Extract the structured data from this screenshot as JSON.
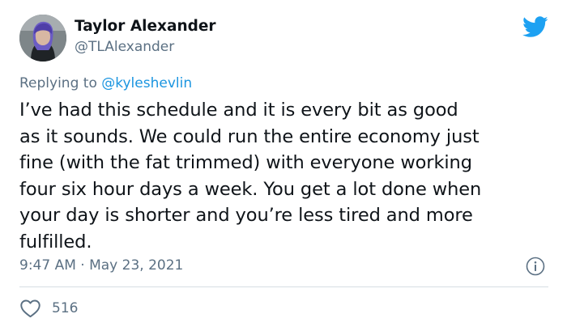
{
  "author": {
    "display_name": "Taylor Alexander",
    "handle": "@TLAlexander",
    "avatar_icon": "avatar-photo"
  },
  "reply": {
    "prefix": "Replying to",
    "mention": "@kyleshevlin"
  },
  "body_lines": [
    "I’ve had this schedule and it is every bit as good",
    "as it sounds. We could run the entire economy just",
    "fine (with the fat trimmed) with everyone working",
    "four six hour days a week. You get a lot done when",
    "your day is shorter and you’re less tired and more",
    "fulfilled."
  ],
  "meta": {
    "timestamp": "9:47 AM · May 23, 2021"
  },
  "actions": {
    "like_count": "516"
  },
  "icons": {
    "brand": "twitter-bird-icon",
    "info": "info-icon",
    "like": "heart-icon"
  },
  "colors": {
    "brand_blue": "#1da1f2",
    "mention_blue": "#1b95e0",
    "secondary_text": "#5b7083",
    "primary_text": "#0f1419",
    "divider": "#d6dde3"
  }
}
